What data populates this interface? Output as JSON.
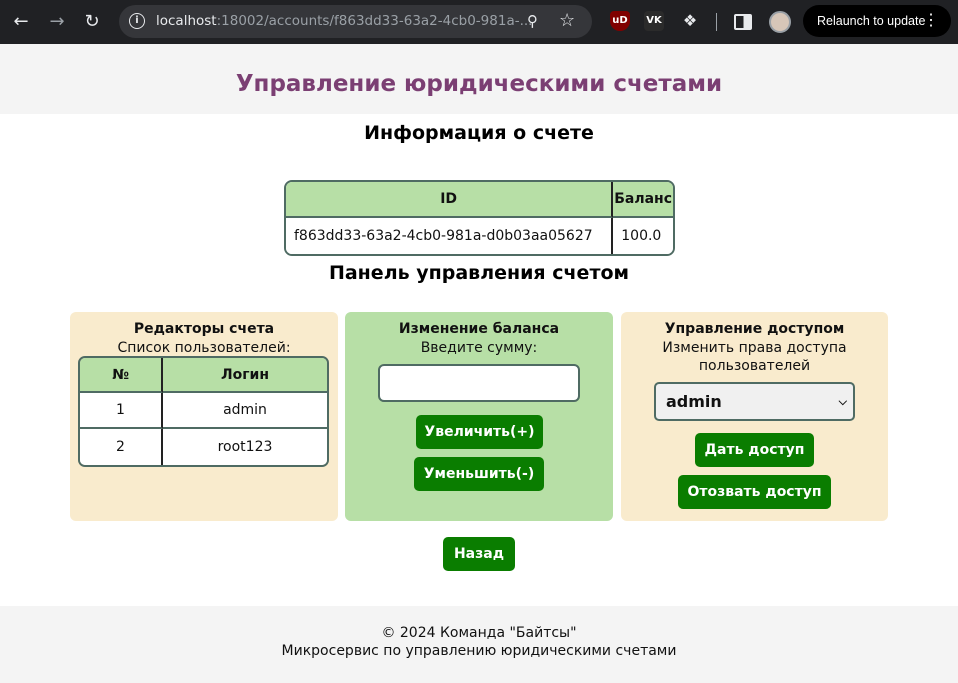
{
  "browser": {
    "url_host": "localhost",
    "url_rest": ":18002/accounts/f863dd33-63a2-4cb0-981a-...",
    "relaunch_label": "Relaunch to update",
    "ext_ublock": "uD",
    "ext_vk": "VK"
  },
  "header": {
    "title": "Управление юридическими счетами"
  },
  "account_info": {
    "heading": "Информация о счете",
    "columns": [
      "ID",
      "Баланс"
    ],
    "id": "f863dd33-63a2-4cb0-981a-d0b03aa05627",
    "balance": "100.0"
  },
  "control_panel": {
    "heading": "Панель управления счетом",
    "editors": {
      "title": "Редакторы счета",
      "subtitle": "Список пользователей:",
      "columns": [
        "№",
        "Логин"
      ],
      "rows": [
        {
          "num": "1",
          "login": "admin"
        },
        {
          "num": "2",
          "login": "root123"
        }
      ]
    },
    "balance": {
      "title": "Изменение баланса",
      "subtitle": "Введите сумму:",
      "amount_value": "",
      "increase_label": "Увеличить(+)",
      "decrease_label": "Уменьшить(-)"
    },
    "access": {
      "title": "Управление доступом",
      "subtitle": "Изменить права доступа пользователей",
      "selected_user": "admin",
      "grant_label": "Дать доступ",
      "revoke_label": "Отозвать доступ"
    }
  },
  "back_label": "Назад",
  "footer": {
    "line1": "© 2024 Команда \"Байтсы\"",
    "line2": "Микросервис по управлению юридическими счетами"
  },
  "colors": {
    "title": "#7b3f73",
    "green_panel": "#b7dfa6",
    "beige_panel": "#f9ebcd",
    "button": "#0a7d00"
  }
}
